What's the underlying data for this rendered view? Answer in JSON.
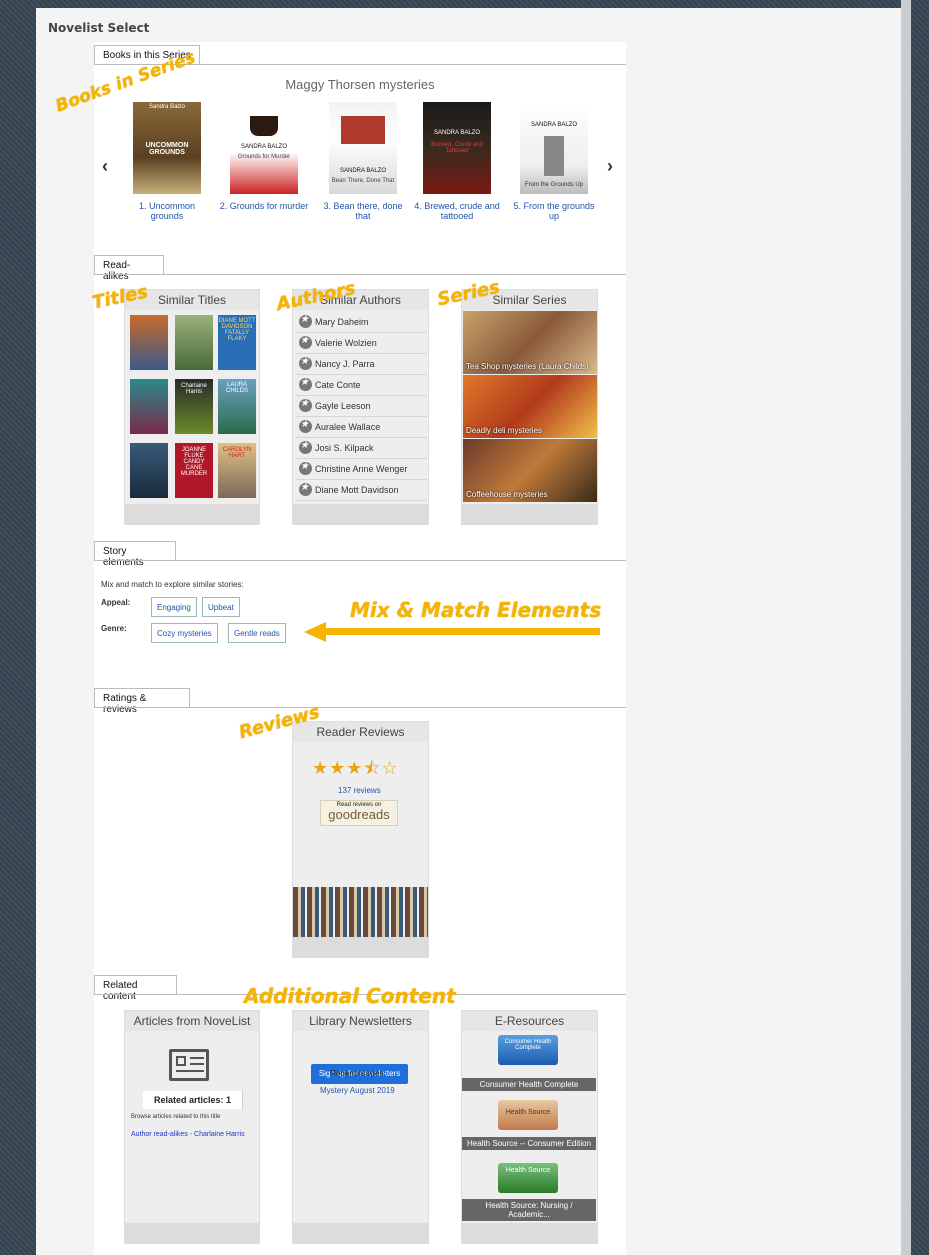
{
  "app_title": "Novelist Select",
  "books_tab": "Books in this Series",
  "series_title": "Maggy Thorsen mysteries",
  "books": [
    {
      "caption": "1. Uncommon grounds",
      "author": "Sandra Balzo",
      "cover_text": "UNCOMMON GROUNDS"
    },
    {
      "caption": "2. Grounds for murder",
      "author": "SANDRA BALZO",
      "cover_text": "Grounds for Murder"
    },
    {
      "caption": "3. Bean there, done that",
      "author": "SANDRA BALZO",
      "cover_text": "Bean There, Done That"
    },
    {
      "caption": "4. Brewed, crude and tattooed",
      "author": "SANDRA BALZO",
      "cover_text": "Brewed, Crude and Tattooed"
    },
    {
      "caption": "5. From the grounds up",
      "author": "SANDRA BALZO",
      "cover_text": "From the Grounds Up"
    }
  ],
  "readalikes_tab": "Read-alikes",
  "similar_titles_head": "Similar Titles",
  "similar_titles_covers": [
    "",
    "",
    "DIANE MOTT DAVIDSON FATALLY FLAKY",
    "",
    "Charlaine Harris",
    "LAURA CHILDS",
    "",
    "JOANNE FLUKE CANDY CANE MURDER",
    "CAROLYN HART"
  ],
  "similar_authors_head": "Similar Authors",
  "authors": [
    "Mary Daheim",
    "Valerie Wolzien",
    "Nancy J. Parra",
    "Cate Conte",
    "Gayle Leeson",
    "Auralee Wallace",
    "Josi S. Kilpack",
    "Christine Anne Wenger",
    "Diane Mott Davidson"
  ],
  "similar_series_head": "Similar Series",
  "series": [
    "Tea Shop mysteries (Laura Childs)",
    "Deadly deli mysteries",
    "Coffeehouse mysteries"
  ],
  "story_tab": "Story elements",
  "story_intro": "Mix and match to explore similar stories:",
  "appeal_label": "Appeal:",
  "appeal": [
    "Engaging",
    "Upbeat"
  ],
  "genre_label": "Genre:",
  "genre": [
    "Cozy mysteries",
    "Gentle reads"
  ],
  "ratings_tab": "Ratings & reviews",
  "reader_reviews_head": "Reader Reviews",
  "rating_stars": 3.5,
  "stars_text": "★★★⯪☆",
  "reviews_count": "137 reviews",
  "goodreads_top": "Read reviews on",
  "goodreads_brand": "goodreads",
  "related_tab": "Related content",
  "articles_head": "Articles from NoveList",
  "related_articles": "Related articles: 1",
  "articles_note": "Browse articles related to this title",
  "article_link": "Author read-alikes - Charlaine Harris",
  "newsletters_head": "Library Newsletters",
  "newsletter_btn": "Sign up for newsletters",
  "recent_issues": "Recent issues:",
  "issue_link": "Mystery August 2019",
  "eres_head": "E-Resources",
  "eresources": [
    "Consumer Health Complete",
    "Health Source -- Consumer Edition",
    "Health Source: Nursing / Academic..."
  ],
  "eres_logos": [
    "Consumer Health Complete",
    "Health Source",
    "Health Source"
  ],
  "annotations": {
    "books_in_series": "Books in Series",
    "titles": "Titles",
    "authors": "Authors",
    "series": "Series",
    "mix_match": "Mix & Match Elements",
    "reviews": "Reviews",
    "additional": "Additional Content"
  },
  "colors": {
    "accent": "#f4b400",
    "link": "#2255aa",
    "button": "#1e6fd9"
  }
}
